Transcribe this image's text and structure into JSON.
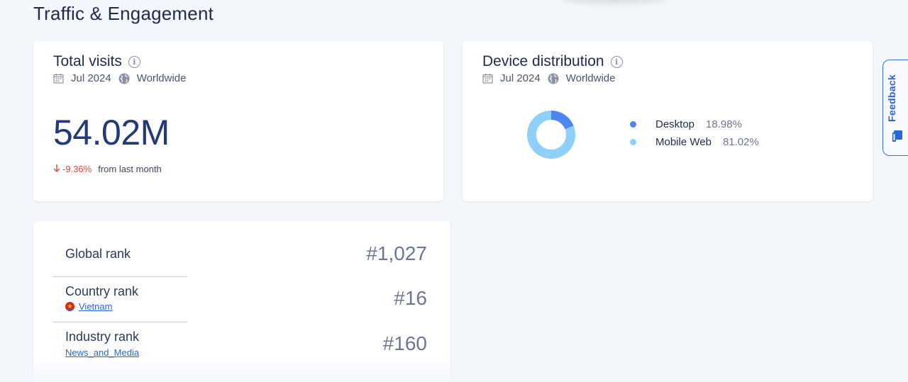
{
  "page": {
    "title": "Traffic & Engagement"
  },
  "total_visits": {
    "title": "Total visits",
    "period": "Jul 2024",
    "region": "Worldwide",
    "value": "54.02M",
    "change": "-9.36%",
    "change_text": "from last month"
  },
  "device_distribution": {
    "title": "Device distribution",
    "period": "Jul 2024",
    "region": "Worldwide",
    "items": [
      {
        "label": "Desktop",
        "value": "18.98%"
      },
      {
        "label": "Mobile Web",
        "value": "81.02%"
      }
    ]
  },
  "ranks": {
    "global": {
      "label": "Global rank",
      "value": "#1,027"
    },
    "country": {
      "label": "Country rank",
      "sub": "Vietnam",
      "value": "#16"
    },
    "industry": {
      "label": "Industry rank",
      "sub": "News_and_Media",
      "value": "#160"
    }
  },
  "feedback": {
    "label": "Feedback"
  },
  "colors": {
    "desktop": "#4d86f2",
    "mobile_web": "#8fd0fb",
    "negative": "#e0483a",
    "link": "#2a64d6"
  },
  "chart_data": {
    "type": "pie",
    "categories": [
      "Desktop",
      "Mobile Web"
    ],
    "values": [
      18.98,
      81.02
    ]
  }
}
